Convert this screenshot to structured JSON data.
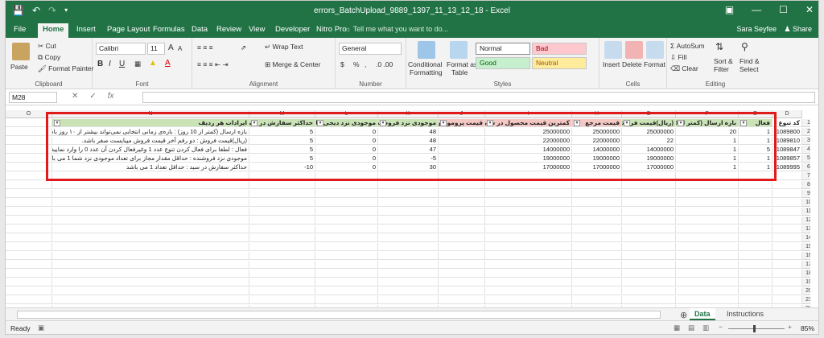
{
  "window": {
    "title": "errors_BatchUpload_9889_1397_11_13_12_18 - Excel",
    "save_icon": "save-icon",
    "undo_icon": "undo-icon",
    "redo_icon": "redo-icon",
    "restore_icon": "ribbon-display-icon",
    "min": "—",
    "max": "☐",
    "close": "✕"
  },
  "tabs": [
    "File",
    "Home",
    "Insert",
    "Page Layout",
    "Formulas",
    "Data",
    "Review",
    "View",
    "Developer",
    "Nitro Pro"
  ],
  "active_tab": "Home",
  "tell_me": "Tell me what you want to do...",
  "user": "Sara Seyfee",
  "share": "Share",
  "ribbon": {
    "clipboard": {
      "paste": "Paste",
      "cut": "Cut",
      "copy": "Copy",
      "format_painter": "Format Painter",
      "label": "Clipboard"
    },
    "font": {
      "name": "Calibri",
      "size": "11",
      "grow": "A",
      "shrink": "A",
      "bold": "B",
      "italic": "I",
      "underline": "U",
      "label": "Font"
    },
    "alignment": {
      "wrap": "Wrap Text",
      "merge": "Merge & Center",
      "label": "Alignment"
    },
    "number": {
      "format": "General",
      "currency": "$",
      "percent": "%",
      "comma": ",",
      "label": "Number"
    },
    "styles": {
      "cond": "Conditional",
      "cond2": "Formatting",
      "table": "Format as",
      "table2": "Table",
      "normal": "Normal",
      "bad": "Bad",
      "good": "Good",
      "neutral": "Neutral",
      "label": "Styles"
    },
    "cells": {
      "insert": "Insert",
      "delete": "Delete",
      "format": "Format",
      "label": "Cells"
    },
    "editing": {
      "autosum": "AutoSum",
      "fill": "Fill",
      "clear": "Clear",
      "sort": "Sort &",
      "sort2": "Filter",
      "find": "Find &",
      "find2": "Select",
      "label": "Editing"
    }
  },
  "formula_bar": {
    "name_box": "M28",
    "fx": "fx",
    "cancel": "✕",
    "enter": "✓",
    "value": ""
  },
  "columns": [
    "O",
    "N",
    "M",
    "L",
    "K",
    "J",
    "I",
    "H",
    "G",
    "F",
    "E",
    "D"
  ],
  "header_row": {
    "N": "ایرادات هر ردیف",
    "M": "حداکثر سفارش در سبد",
    "L": "موجودی نزد دیجی کالا",
    "K": "موجودی نزد فروشند",
    "J": "قیمت پروموشن",
    "I": "کمترین قیمت محصول در سایت",
    "H": "قیمت مرجع",
    "G": "(ریال)قیمت فروش",
    "F": "بازه ارسال (کمتر از 10",
    "E": "فعال",
    "D": "کد تنوع"
  },
  "rows": [
    {
      "N": "بازه ارسال (کمتر از 10 روز) : بازه‌ی زمانی انتخابی نمی‌تواند بیشتر از ۱۰ روز باشد.",
      "M": "5",
      "L": "0",
      "K": "48",
      "J": "",
      "I": "25000000",
      "H": "25000000",
      "G": "25000000",
      "F": "20",
      "E": "1",
      "D": "1089800"
    },
    {
      "N": "(ریال)قیمت فروش : دو رقم آخر قیمت فروش میبایست صفر باشد.",
      "M": "5",
      "L": "0",
      "K": "48",
      "J": "",
      "I": "22000000",
      "H": "22000000",
      "G": "22",
      "F": "1",
      "E": "1",
      "D": "1089810"
    },
    {
      "N": "فعال : لطفا برای فعال کردن تنوع عدد 1 وغیرفعال کردن آن عدد 0 را وارد نمایید.",
      "M": "5",
      "L": "0",
      "K": "47",
      "J": "",
      "I": "14000000",
      "H": "14000000",
      "G": "14000000",
      "F": "1",
      "E": "5",
      "D": "1089847"
    },
    {
      "N": "موجودی نزد فروشنده : حداقل مقدار مجاز برای تعداد موجودی نزد شما 1 می باشد",
      "M": "5",
      "L": "0",
      "K": "-5",
      "J": "",
      "I": "19000000",
      "H": "19000000",
      "G": "19000000",
      "F": "1",
      "E": "1",
      "D": "1089857"
    },
    {
      "N": "حداکثر سفارش در سبد : حداقل تعداد 1 می باشد",
      "M": "-10",
      "L": "0",
      "K": "30",
      "J": "",
      "I": "17000000",
      "H": "17000000",
      "G": "17000000",
      "F": "1",
      "E": "1",
      "D": "1089995"
    }
  ],
  "row_numbers": [
    "1",
    "2",
    "3",
    "4",
    "5",
    "6",
    "7",
    "8",
    "9",
    "10",
    "11",
    "12",
    "13",
    "14",
    "15",
    "16",
    "17",
    "18",
    "19",
    "20",
    "21",
    "22",
    "23",
    "24"
  ],
  "sheets": [
    "Data",
    "Instructions"
  ],
  "active_sheet": "Data",
  "status": {
    "ready": "Ready",
    "zoom": "85%"
  }
}
